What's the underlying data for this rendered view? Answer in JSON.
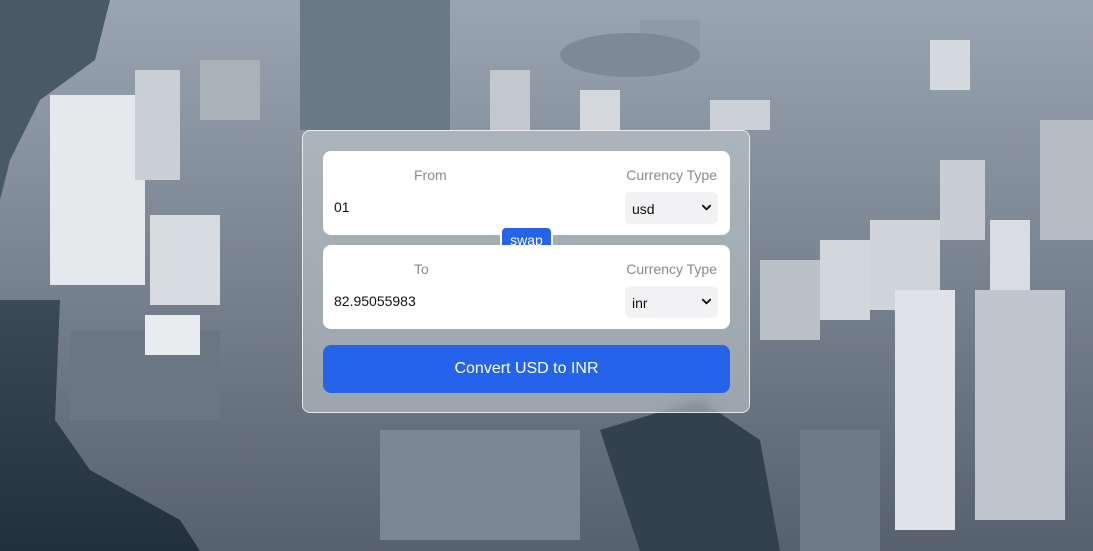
{
  "converter": {
    "from": {
      "label": "From",
      "currency_type_label": "Currency Type",
      "amount": "01",
      "currency": "usd"
    },
    "to": {
      "label": "To",
      "currency_type_label": "Currency Type",
      "amount": "82.95055983",
      "currency": "inr"
    },
    "swap_label": "swap",
    "convert_label": "Convert USD to INR"
  },
  "colors": {
    "accent": "#2563eb",
    "panel": "#ffffff",
    "label": "#8a8a8a"
  },
  "icons": {
    "select_chevron": "chevron-down-icon"
  }
}
